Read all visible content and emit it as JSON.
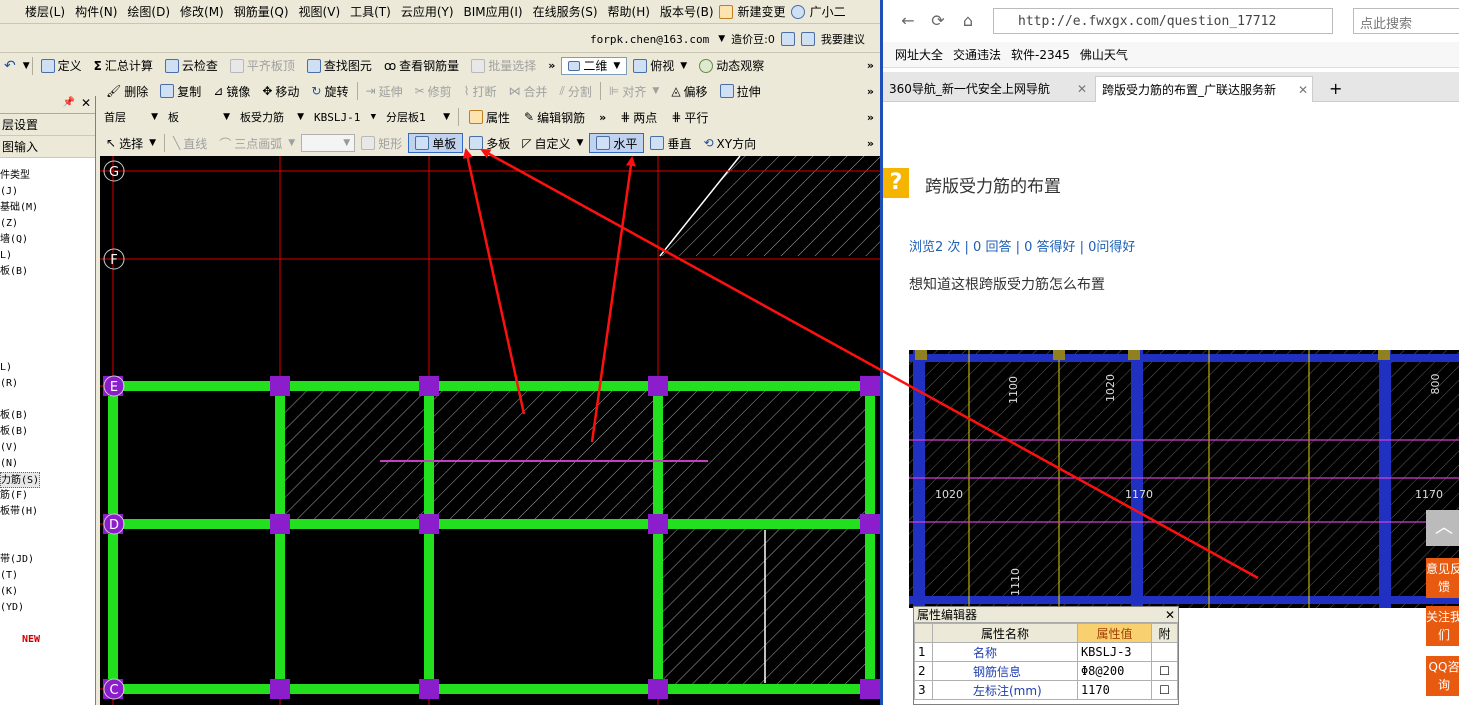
{
  "menu": [
    "楼层(L)",
    "构件(N)",
    "绘图(D)",
    "修改(M)",
    "钢筋量(Q)",
    "视图(V)",
    "工具(T)",
    "云应用(Y)",
    "BIM应用(I)",
    "在线服务(S)",
    "帮助(H)",
    "版本号(B)",
    "新建变更",
    "广小二"
  ],
  "account": {
    "email": "forpk.chen@163.com",
    "cost": "造价豆:0",
    "suggest": "我要建议"
  },
  "toolbar1": {
    "define": "定义",
    "calc": "汇总计算",
    "cloud_check": "云检查",
    "align_top": "平齐板顶",
    "find": "查找图元",
    "view_rebar": "查看钢筋量",
    "batch": "批量选择",
    "view2d": "二维",
    "top_view": "俯视",
    "dynamic": "动态观察"
  },
  "toolbar2": {
    "delete": "删除",
    "copy": "复制",
    "mirror": "镜像",
    "move": "移动",
    "rotate": "旋转",
    "extend": "延伸",
    "trim": "修剪",
    "break": "打断",
    "merge": "合并",
    "split": "分割",
    "align": "对齐",
    "offset": "偏移",
    "stretch": "拉伸"
  },
  "toolbar3": {
    "floor": "首层",
    "category": "板",
    "type": "板受力筋",
    "name": "KBSLJ-1",
    "layer": "分层板1",
    "property": "属性",
    "edit_rebar": "编辑钢筋",
    "two_point": "两点",
    "parallel": "平行"
  },
  "toolbar4": {
    "select": "选择",
    "line": "直线",
    "arc": "三点画弧",
    "rect": "矩形",
    "single": "单板",
    "multi": "多板",
    "custom": "自定义",
    "horizontal": "水平",
    "vertical": "垂直",
    "xy": "XY方向"
  },
  "sidebar": {
    "rows": [
      "层设置",
      "图输入"
    ],
    "tree": [
      "件类型",
      "(J)",
      "基础(M)",
      "(Z)",
      "墙(Q)",
      "L)",
      "板(B)",
      "",
      "",
      "",
      "",
      "",
      "L)",
      "(R)",
      "",
      "板(B)",
      "板(B)",
      "(V)",
      "(N)",
      "力筋(S)",
      "筋(F)",
      "板带(H)",
      "",
      "",
      "带(JD)",
      "(T)",
      "(K)",
      "(YD)",
      "",
      "NEW"
    ],
    "selected_index": 19
  },
  "axes": [
    "G",
    "F",
    "E",
    "D",
    "C"
  ],
  "browser": {
    "url": "http://e.fwxgx.com/question_17712",
    "search_placeholder": "点此搜索",
    "bookmarks": [
      "网址大全",
      "交通违法",
      "软件-2345",
      "佛山天气"
    ],
    "tabs": [
      {
        "label": "360导航_新一代安全上网导航",
        "active": false
      },
      {
        "label": "跨版受力筋的布置_广联达服务新",
        "active": true
      }
    ]
  },
  "question": {
    "title": "跨版受力筋的布置",
    "stats": "浏览2 次 | 0 回答 | 0 答得好 | 0问得好",
    "description": "想知道这根跨版受力筋怎么布置",
    "image_labels": [
      "1100",
      "1020",
      "1020",
      "1170",
      "1170",
      "1110",
      "800"
    ]
  },
  "props": {
    "title": "属性编辑器",
    "headers": [
      "属性名称",
      "属性值",
      "附"
    ],
    "rows": [
      {
        "n": "1",
        "name": "名称",
        "value": "KBSLJ-3"
      },
      {
        "n": "2",
        "name": "钢筋信息",
        "value": "Φ8@200"
      },
      {
        "n": "3",
        "name": "左标注(mm)",
        "value": "1170"
      }
    ]
  },
  "float_buttons": [
    "意见反馈",
    "关注我们",
    "QQ咨询"
  ],
  "colors": {
    "beam": "#22e01e",
    "column": "#8b1dcc",
    "grid": "#e00000",
    "rebar": "#c040c0",
    "arrow": "#ff1010",
    "browser_accent": "#1e4fb8"
  }
}
